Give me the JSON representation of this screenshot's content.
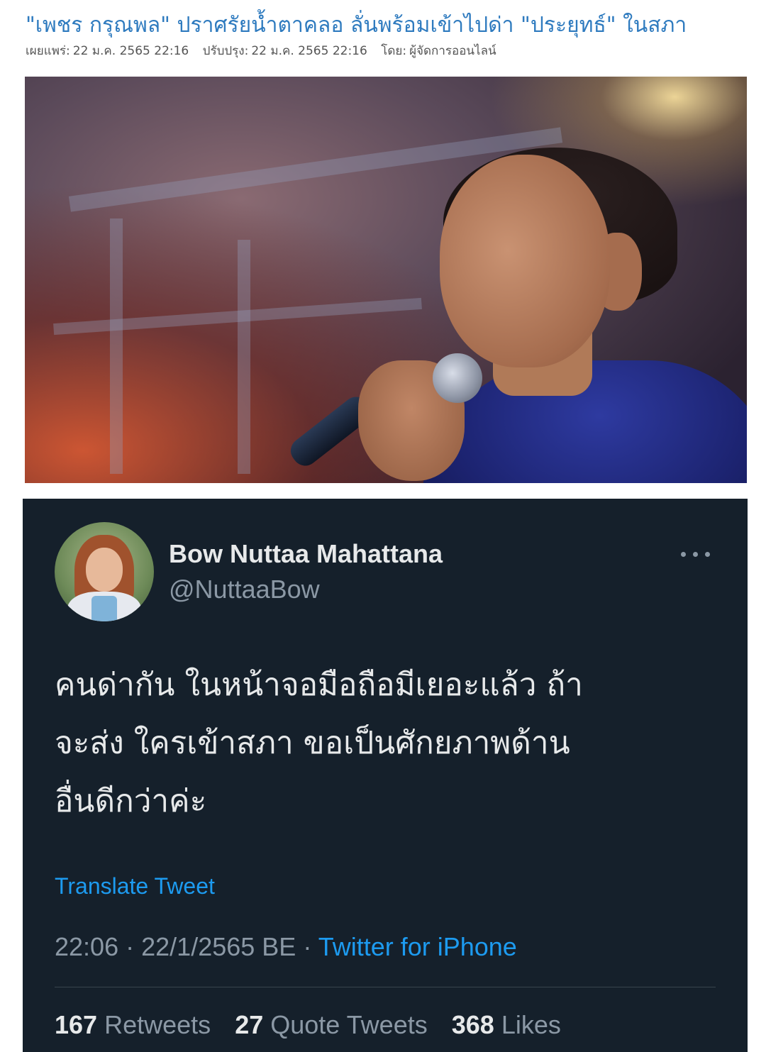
{
  "article": {
    "headline": "\"เพชร กรุณพล\" ปราศรัยน้ำตาคลอ ลั่นพร้อมเข้าไปด่า \"ประยุทธ์\" ในสภา",
    "published_label": "เผยแพร่:",
    "published_value": "22 ม.ค. 2565 22:16",
    "updated_label": "ปรับปรุง:",
    "updated_value": "22 ม.ค. 2565 22:16",
    "author_label": "โดย:",
    "author_value": "ผู้จัดการออนไลน์"
  },
  "tweet": {
    "display_name": "Bow Nuttaa Mahattana",
    "handle": "@NuttaaBow",
    "more_icon": "ellipsis-horizontal",
    "lines": [
      "คนด่ากัน ในหน้าจอมือถือมีเยอะแล้ว ถ้า",
      "จะส่ง ใครเข้าสภา ขอเป็นศักยภาพด้าน",
      "อื่นดีกว่าค่ะ"
    ],
    "translate_label": "Translate Tweet",
    "time": "22:06",
    "date": "22/1/2565 BE",
    "separator": "·",
    "source": "Twitter for iPhone",
    "retweets_count": "167",
    "retweets_label": "Retweets",
    "quotes_count": "27",
    "quotes_label": "Quote Tweets",
    "likes_count": "368",
    "likes_label": "Likes"
  },
  "colors": {
    "headline": "#2f7bbf",
    "tweet_bg": "#15202b",
    "link": "#1d9bf0",
    "muted": "#8b98a5"
  }
}
